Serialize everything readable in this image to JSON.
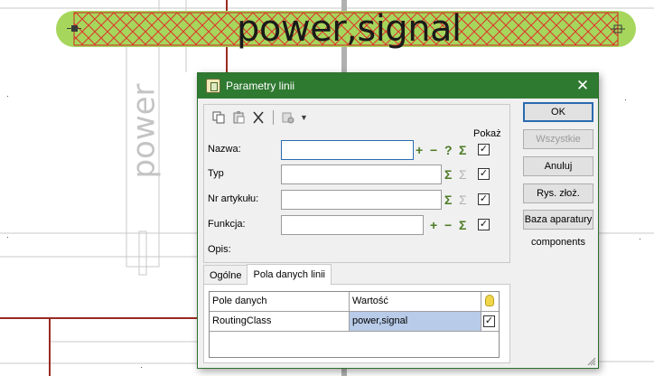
{
  "canvas": {
    "label_horizontal": "power,signal",
    "label_vertical": "power"
  },
  "dialog": {
    "title": "Parametry linii",
    "close_glyph": "✕",
    "toolbar": {
      "icons": [
        "copy-icon",
        "paste-icon",
        "cut-icon",
        "settings-icon"
      ],
      "dropdown_glyph": "▼"
    },
    "pokaz_label": "Pokaż",
    "fields": [
      {
        "label": "Nazwa:",
        "value": "",
        "icons": [
          "+",
          "−",
          "?",
          "Σ"
        ],
        "checked": true
      },
      {
        "label": "Typ",
        "value": "",
        "icons": [
          "Σ",
          "Σ"
        ],
        "checked": true
      },
      {
        "label": "Nr artykułu:",
        "value": "",
        "icons": [
          "Σ",
          "Σ"
        ],
        "checked": true
      },
      {
        "label": "Funkcja:",
        "value": "",
        "icons": [
          "+",
          "−",
          "Σ"
        ],
        "checked": true
      }
    ],
    "opis_label": "Opis:",
    "buttons": {
      "ok": "OK",
      "wszystkie": "Wszystkie",
      "anuluj": "Anuluj",
      "rys": "Rys. złoż.",
      "baza": "Baza aparatury"
    },
    "components_label": "components",
    "tabs": [
      "Ogólne",
      "Pola danych linii"
    ],
    "grid": {
      "headers": [
        "Pole danych",
        "Wartość"
      ],
      "rows": [
        {
          "field": "RoutingClass",
          "value": "power,signal",
          "checked": true
        }
      ]
    },
    "check_glyph": "✓"
  },
  "colors": {
    "title_bar": "#2f7a31",
    "line_fill": "#a6d65c",
    "line_hatch": "#e0302a",
    "wire": "#9a2b22",
    "selection": "#b8cbe8"
  }
}
